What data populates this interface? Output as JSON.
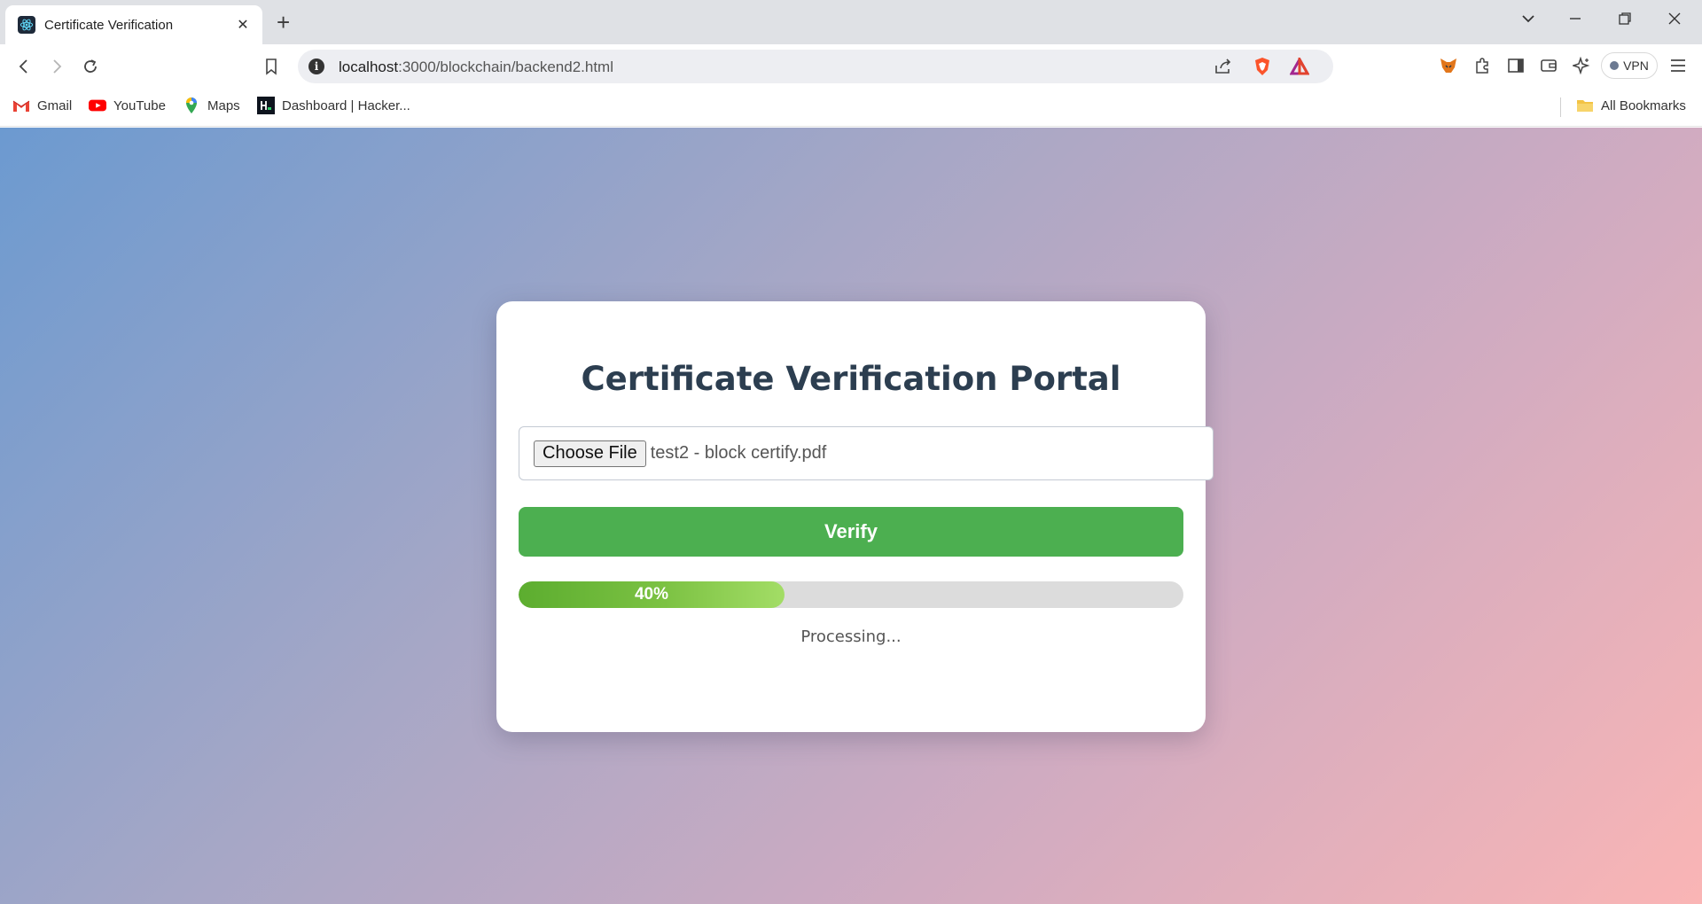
{
  "browser": {
    "tab": {
      "title": "Certificate Verification",
      "favicon": "react-atom-icon"
    },
    "address_bar": {
      "host": "localhost",
      "path": ":3000/blockchain/backend2.html"
    },
    "bookmarks": [
      {
        "label": "Gmail",
        "icon": "gmail-icon"
      },
      {
        "label": "YouTube",
        "icon": "youtube-icon"
      },
      {
        "label": "Maps",
        "icon": "maps-icon"
      },
      {
        "label": "Dashboard | Hacker...",
        "icon": "hackerrank-icon"
      }
    ],
    "all_bookmarks_label": "All Bookmarks",
    "vpn_label": "VPN"
  },
  "portal": {
    "title": "Certificate Verification Portal",
    "file_input": {
      "button_label": "Choose File",
      "file_name": "test2 - block certify.pdf"
    },
    "verify_label": "Verify",
    "progress": {
      "percent": 40,
      "label": "40%"
    },
    "status": "Processing..."
  },
  "colors": {
    "verify_button": "#4caf50",
    "title": "#2c3e50",
    "progress_fill": "#7cc243",
    "progress_track": "#dcdcdc",
    "gradient_start": "#6c9ad0",
    "gradient_end": "#fab5b5"
  }
}
